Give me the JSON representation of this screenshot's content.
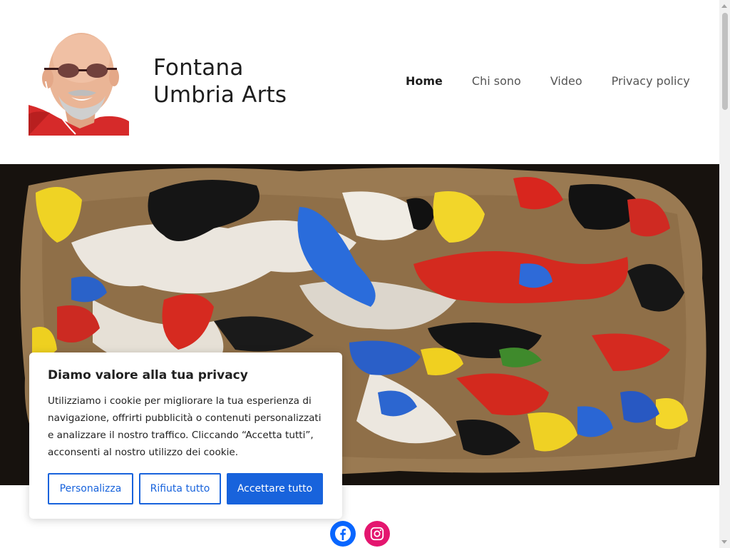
{
  "site": {
    "title": "Fontana Umbria Arts",
    "title_line1": "Fontana",
    "title_line2": "Umbria Arts"
  },
  "nav": {
    "items": [
      {
        "label": "Home",
        "active": true
      },
      {
        "label": "Chi sono",
        "active": false
      },
      {
        "label": "Video",
        "active": false
      },
      {
        "label": "Privacy policy",
        "active": false
      }
    ]
  },
  "cookie": {
    "title": "Diamo valore alla tua privacy",
    "text": "Utilizziamo i cookie per migliorare la tua esperienza di navigazione, offrirti pubblicità o contenuti personalizzati e analizzare il nostro traffico. Cliccando “Accetta tutti”, acconsenti al nostro utilizzo dei cookie.",
    "buttons": {
      "customize": "Personalizza",
      "reject": "Rifiuta tutto",
      "accept": "Accettare tutto"
    }
  },
  "social": {
    "items": [
      {
        "icon": "facebook-icon",
        "color": "#0866ff"
      },
      {
        "icon": "instagram-icon",
        "color": "#e4166f"
      }
    ]
  },
  "colors": {
    "accent": "#1863dc",
    "text": "#1e1e1e",
    "nav_inactive": "#555555"
  }
}
